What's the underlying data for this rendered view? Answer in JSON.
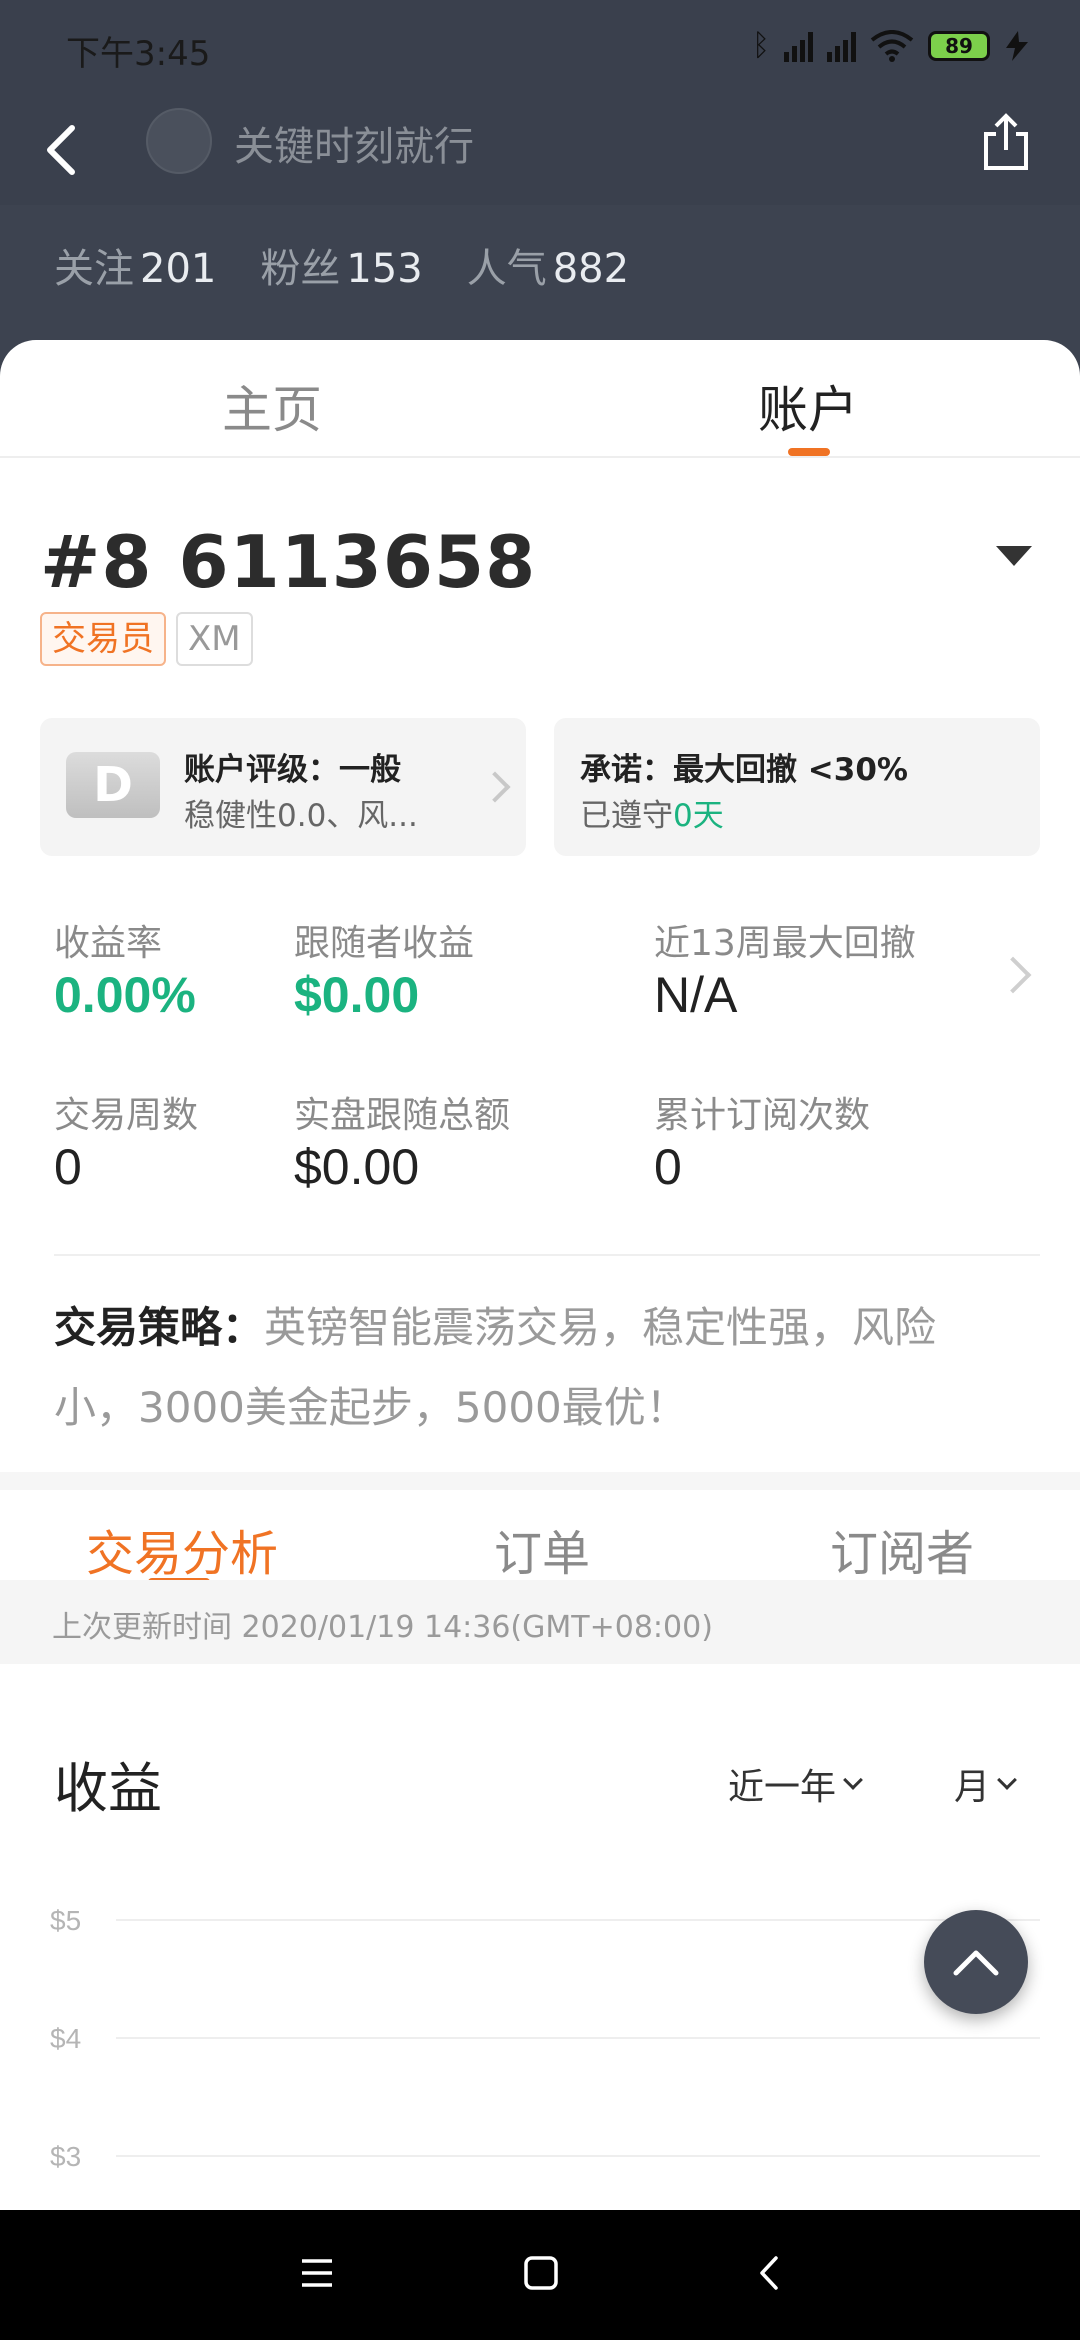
{
  "status_bar": {
    "time": "下午3:45",
    "battery": "89"
  },
  "header": {
    "title": "关键时刻就行",
    "stats": [
      {
        "label": "关注",
        "value": "201"
      },
      {
        "label": "粉丝",
        "value": "153"
      },
      {
        "label": "人气",
        "value": "882"
      }
    ]
  },
  "top_tabs": [
    {
      "label": "主页"
    },
    {
      "label": "账户"
    }
  ],
  "account": {
    "number": "#8 6113658",
    "badges": [
      "交易员",
      "XM"
    ]
  },
  "rating_box": {
    "icon_letter": "D",
    "title": "账户评级：一般",
    "subtitle": "稳健性0.0、风..."
  },
  "promise_box": {
    "title": "承诺：最大回撤 <30%",
    "sub_prefix": "已遵守",
    "sub_days": "0天"
  },
  "metrics": [
    {
      "label": "收益率",
      "value": "0.00%"
    },
    {
      "label": "跟随者收益",
      "value": "$0.00"
    },
    {
      "label": "近13周最大回撤",
      "value": "N/A"
    },
    {
      "label": "交易周数",
      "value": "0"
    },
    {
      "label": "实盘跟随总额",
      "value": "$0.00"
    },
    {
      "label": "累计订阅次数",
      "value": "0"
    }
  ],
  "strategy": {
    "label": "交易策略：",
    "text": "英镑智能震荡交易，稳定性强，风险小，3000美金起步，5000最优！"
  },
  "bottom_tabs": [
    {
      "label": "交易分析"
    },
    {
      "label": "订单"
    },
    {
      "label": "订阅者"
    }
  ],
  "update": {
    "text": "上次更新时间 2020/01/19 14:36(GMT+08:00)"
  },
  "earnings": {
    "title": "收益",
    "filter_period": "近一年",
    "filter_unit": "月"
  },
  "chart_data": {
    "type": "line",
    "title": "收益",
    "x": [],
    "series": [
      {
        "values": []
      }
    ],
    "yticks": [
      "$5",
      "$4",
      "$3"
    ],
    "ylim": [
      3,
      5
    ]
  },
  "colors": {
    "accent": "#f07324",
    "positive": "#1bb380",
    "header_bg": "#3d4350"
  }
}
